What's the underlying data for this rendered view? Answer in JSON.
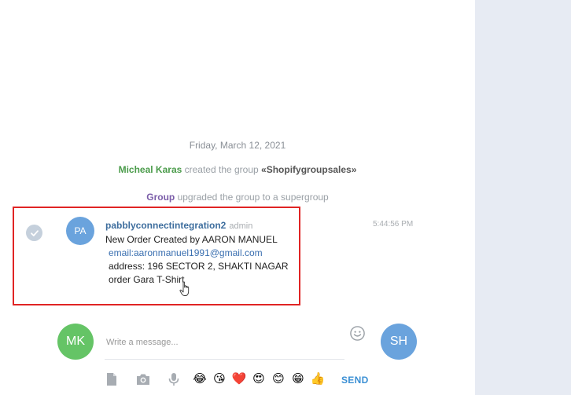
{
  "chat": {
    "date_separator": "Friday, March 12, 2021",
    "service": [
      {
        "user": "Micheal Karas",
        "text": " created the group ",
        "group": "«Shopifygroupsales»"
      },
      {
        "user": "Group",
        "text": " upgraded the group to a supergroup"
      }
    ],
    "message": {
      "avatar_initials": "PA",
      "author": "pabblyconnectintegration2",
      "role": "admin",
      "time": "5:44:56 PM",
      "lines": [
        "New Order Created by AARON MANUEL",
        "email:aaronmanuel1991@gmail.com",
        "address: 196 SECTOR 2, SHAKTI NAGAR",
        "order Gara T-Shirt"
      ]
    }
  },
  "composer": {
    "self_avatar": "MK",
    "peer_avatar": "SH",
    "placeholder": "Write a message...",
    "send_label": "SEND",
    "icons": [
      "document-icon",
      "camera-icon",
      "microphone-icon",
      "smiley-icon"
    ],
    "quick_emojis": [
      "😂",
      "😘",
      "❤️",
      "😍",
      "😊",
      "😁",
      "👍"
    ]
  },
  "colors": {
    "highlight_border": "#e02424",
    "author": "#3e6e9e",
    "link": "#3a6fb0",
    "send": "#3a8fd4",
    "right_panel": "#e7ebf3"
  }
}
